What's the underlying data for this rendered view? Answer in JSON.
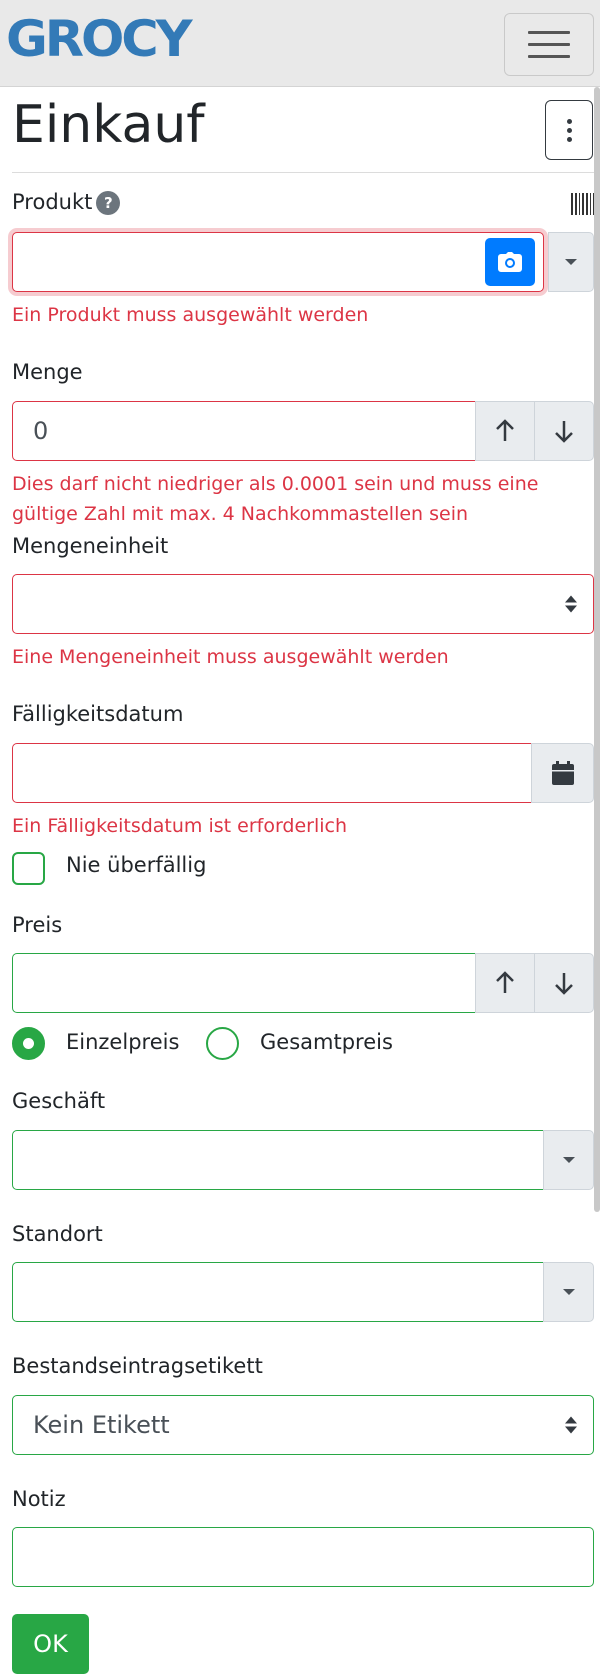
{
  "app": {
    "logo_text": "GROCY"
  },
  "page": {
    "title": "Einkauf"
  },
  "product": {
    "label": "Produkt",
    "help": "?",
    "value": "",
    "error": "Ein Produkt muss ausgewählt werden"
  },
  "amount": {
    "label": "Menge",
    "value": "0",
    "error_line1": "Dies darf nicht niedriger als 0.0001 sein und muss eine",
    "error_line2": "gültige Zahl mit max. 4 Nachkommastellen sein"
  },
  "unit": {
    "label": "Mengeneinheit",
    "value": "",
    "error": "Eine Mengeneinheit muss ausgewählt werden"
  },
  "due_date": {
    "label": "Fälligkeitsdatum",
    "value": "",
    "error": "Ein Fälligkeitsdatum ist erforderlich",
    "never_overdue_label": "Nie überfällig",
    "never_overdue_checked": false
  },
  "price": {
    "label": "Preis",
    "value": "",
    "unit_price_label": "Einzelpreis",
    "total_price_label": "Gesamtpreis",
    "selected": "Einzelpreis"
  },
  "store": {
    "label": "Geschäft",
    "value": ""
  },
  "location": {
    "label": "Standort",
    "value": ""
  },
  "stock_label": {
    "label": "Bestandseintragsetikett",
    "value": "Kein Etikett"
  },
  "note": {
    "label": "Notiz",
    "value": ""
  },
  "submit": {
    "label": "OK"
  },
  "colors": {
    "brand": "#337ab7",
    "danger": "#dc3545",
    "success": "#28a745",
    "primary": "#007bff"
  },
  "icons": [
    "menu-icon",
    "more-vertical-icon",
    "help-icon",
    "barcode-icon",
    "camera-icon",
    "chevron-down-icon",
    "arrow-up-icon",
    "arrow-down-icon",
    "calendar-icon",
    "select-arrows-icon"
  ]
}
